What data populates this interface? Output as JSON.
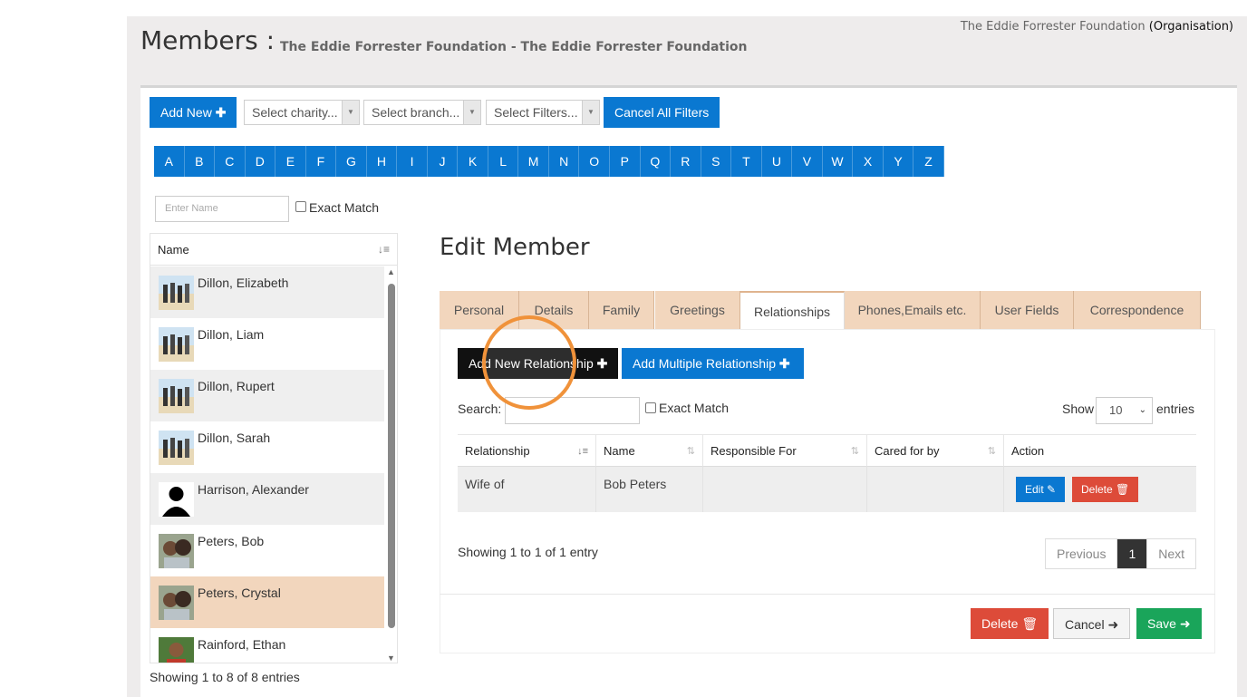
{
  "header": {
    "title": "Members :",
    "subtitle": "The Eddie Forrester Foundation - The Eddie Forrester Foundation",
    "org_name": "The Eddie Forrester Foundation",
    "org_type": "(Organisation)"
  },
  "toolbar": {
    "add_new_label": "Add New",
    "charity_placeholder": "Select charity...",
    "branch_placeholder": "Select branch...",
    "filters_placeholder": "Select Filters...",
    "cancel_filters_label": "Cancel All Filters"
  },
  "alphabet": [
    "A",
    "B",
    "C",
    "D",
    "E",
    "F",
    "G",
    "H",
    "I",
    "J",
    "K",
    "L",
    "M",
    "N",
    "O",
    "P",
    "Q",
    "R",
    "S",
    "T",
    "U",
    "V",
    "W",
    "X",
    "Y",
    "Z"
  ],
  "search": {
    "name_placeholder": "Enter Name",
    "exact_match_label": "Exact Match"
  },
  "member_list": {
    "header": "Name",
    "members": [
      {
        "name": "Dillon, Elizabeth",
        "avatar": "beach-photo",
        "selected": false
      },
      {
        "name": "Dillon, Liam",
        "avatar": "beach-photo",
        "selected": false
      },
      {
        "name": "Dillon, Rupert",
        "avatar": "beach-photo",
        "selected": false
      },
      {
        "name": "Dillon, Sarah",
        "avatar": "beach-photo",
        "selected": false
      },
      {
        "name": "Harrison, Alexander",
        "avatar": "silhouette",
        "selected": false
      },
      {
        "name": "Peters, Bob",
        "avatar": "couple-photo",
        "selected": false
      },
      {
        "name": "Peters, Crystal",
        "avatar": "couple-photo",
        "selected": true
      },
      {
        "name": "Rainford, Ethan",
        "avatar": "portrait-photo",
        "selected": false
      }
    ],
    "footer": "Showing 1 to 8 of 8 entries"
  },
  "edit": {
    "title": "Edit Member",
    "tabs": [
      {
        "label": "Personal",
        "active": false
      },
      {
        "label": "Details",
        "active": false
      },
      {
        "label": "Family",
        "active": false
      },
      {
        "label": "Greetings",
        "active": false
      },
      {
        "label": "Relationships",
        "active": true
      },
      {
        "label": "Phones,Emails etc.",
        "active": false
      },
      {
        "label": "User Fields",
        "active": false
      },
      {
        "label": "Correspondence",
        "active": false
      }
    ],
    "add_relationship_label": "Add New Relationship",
    "add_multiple_label": "Add Multiple Relationship",
    "search_label": "Search:",
    "exact_match_label": "Exact Match",
    "show_label": "Show",
    "entries_label": "entries",
    "page_length": "10",
    "table": {
      "columns": [
        "Relationship",
        "Name",
        "Responsible For",
        "Cared for by",
        "Action"
      ],
      "rows": [
        {
          "relationship": "Wife of",
          "name": "Bob Peters",
          "responsible_for": "",
          "cared_for_by": ""
        }
      ],
      "edit_label": "Edit",
      "delete_label": "Delete"
    },
    "table_info": "Showing 1 to 1 of 1 entry",
    "pagination": {
      "previous": "Previous",
      "current": "1",
      "next": "Next"
    },
    "footer_buttons": {
      "delete": "Delete",
      "cancel": "Cancel",
      "save": "Save"
    }
  },
  "colors": {
    "primary": "#0a78d1",
    "tab_bg": "#f2d6bd",
    "selected_row": "#f2d6bd",
    "danger": "#dd4b39",
    "success": "#1aa55a",
    "highlight_ring": "#f0923a"
  }
}
